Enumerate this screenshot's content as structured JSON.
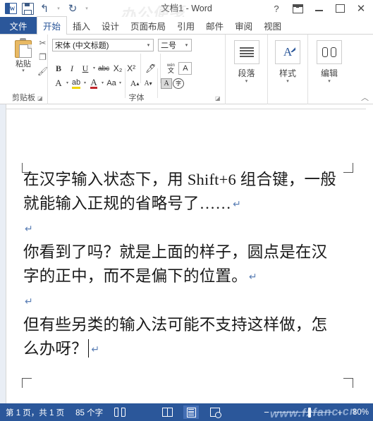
{
  "window": {
    "title": "文档1 - Word",
    "quick_access": [
      {
        "name": "word-logo",
        "label": "W"
      },
      {
        "name": "save",
        "label": "保存"
      },
      {
        "name": "undo",
        "label": "撤消"
      },
      {
        "name": "redo",
        "label": "恢复"
      },
      {
        "name": "customize",
        "label": "自定义快速访问工具栏"
      }
    ],
    "controls": {
      "help": "?",
      "ribbon_display": "功能区显示选项",
      "minimize": "最小化",
      "maximize": "最大化",
      "close": "✕"
    }
  },
  "tabs": [
    {
      "label": "文件",
      "active": false,
      "file": true
    },
    {
      "label": "开始",
      "active": true
    },
    {
      "label": "插入",
      "active": false
    },
    {
      "label": "设计",
      "active": false
    },
    {
      "label": "页面布局",
      "active": false
    },
    {
      "label": "引用",
      "active": false
    },
    {
      "label": "邮件",
      "active": false
    },
    {
      "label": "审阅",
      "active": false
    },
    {
      "label": "视图",
      "active": false
    }
  ],
  "ribbon": {
    "clipboard": {
      "group_label": "剪贴板",
      "paste_label": "粘贴",
      "cut_label": "剪切",
      "copy_label": "复制",
      "format_painter_label": "格式刷",
      "launcher": "⌐"
    },
    "font": {
      "group_label": "字体",
      "font_name": "宋体 (中文标题)",
      "font_size": "二号",
      "bold": "B",
      "italic": "I",
      "underline": "U",
      "strikethrough": "abc",
      "subscript": "X₂",
      "superscript": "X²",
      "text_effects": "A",
      "highlight": "ab",
      "font_color": "A",
      "change_case": "Aa",
      "grow_font": "A",
      "shrink_font": "A",
      "clear_formatting": "A",
      "phonetic_guide_top": "wén",
      "phonetic_guide_bottom": "文",
      "char_border": "A",
      "char_shading": "A",
      "enclose_char": "字",
      "launcher": "⌐"
    },
    "paragraph": {
      "label": "段落",
      "caret": "▾"
    },
    "styles": {
      "label": "样式",
      "caret": "▾"
    },
    "editing": {
      "label": "编辑",
      "caret": "▾"
    },
    "collapse": "︿"
  },
  "document": {
    "paragraphs": [
      {
        "text": "在汉字输入状态下，用 Shift+6 组合键，一般就能输入正规的省略号了……",
        "mark": "↵",
        "empty": false,
        "caret": false
      },
      {
        "text": "",
        "mark": "↵",
        "empty": true,
        "caret": false
      },
      {
        "text": "你看到了吗？就是上面的样子，圆点是在汉字的正中，而不是偏下的位置。",
        "mark": "↵",
        "empty": false,
        "caret": false
      },
      {
        "text": "",
        "mark": "↵",
        "empty": true,
        "caret": false
      },
      {
        "text": "但有些另类的输入法可能不支持这样做，怎么办呀？",
        "mark": "↵",
        "empty": false,
        "caret": true
      }
    ]
  },
  "status_bar": {
    "page_info": "第 1 页，共 1 页",
    "word_count": "85 个字",
    "proofing_label": "校对",
    "views": [
      {
        "name": "read-mode",
        "label": "阅读视图",
        "active": false
      },
      {
        "name": "print-layout",
        "label": "页面视图",
        "active": true
      },
      {
        "name": "web-layout",
        "label": "Web 版式视图",
        "active": false
      }
    ],
    "zoom_out": "−",
    "zoom_in": "+",
    "zoom_percent": "80%"
  },
  "watermarks": {
    "status": "www.fzfanc.cn",
    "top": "办公便笺"
  },
  "colors": {
    "accent": "#2b579a",
    "tab_active_text": "#2b579a",
    "statusbar_bg": "#2b579a",
    "ribbon_border": "#d4d4d4",
    "paste_board": "#e8b964",
    "highlight_yellow": "#f2d600",
    "font_color_red": "#c0262b"
  }
}
